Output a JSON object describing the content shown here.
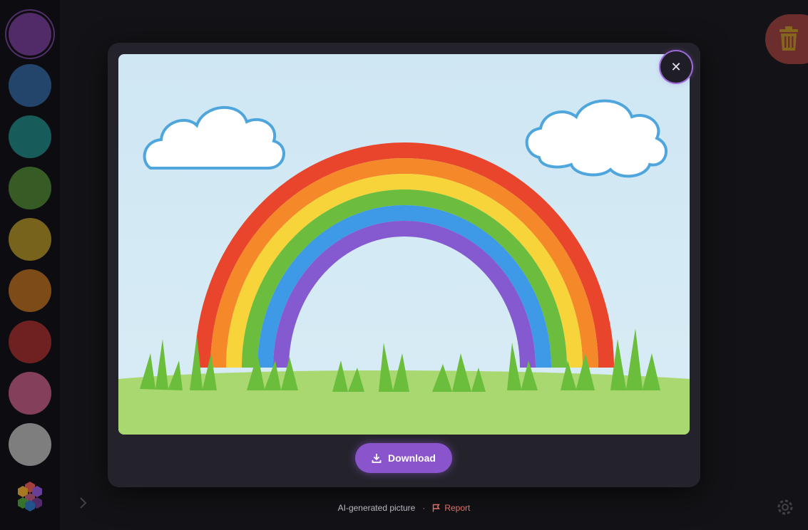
{
  "palette": {
    "colors": [
      "#6b3a8a",
      "#2f5d8f",
      "#1f7a78",
      "#4a7a32",
      "#a08526",
      "#a66420",
      "#952b2b",
      "#b05478",
      "#a9a9a9"
    ],
    "selected_index": 0,
    "multicolor_icon": "hexagon-palette-icon"
  },
  "modal": {
    "picture_subject": "rainbow-with-clouds-and-grass",
    "close_icon": "close-icon",
    "close_glyph": "✕",
    "download_label": "Download",
    "download_icon": "download-icon"
  },
  "footer": {
    "caption": "AI-generated picture",
    "separator": "·",
    "report_label": "Report",
    "report_icon": "flag-icon"
  },
  "toolbar": {
    "trash_icon": "trash-icon",
    "settings_icon": "gear-icon",
    "expand_icon": "chevron-right-icon"
  },
  "colors": {
    "accent": "#8a55cc",
    "trash": "#b84a47",
    "report": "#e0706a"
  }
}
